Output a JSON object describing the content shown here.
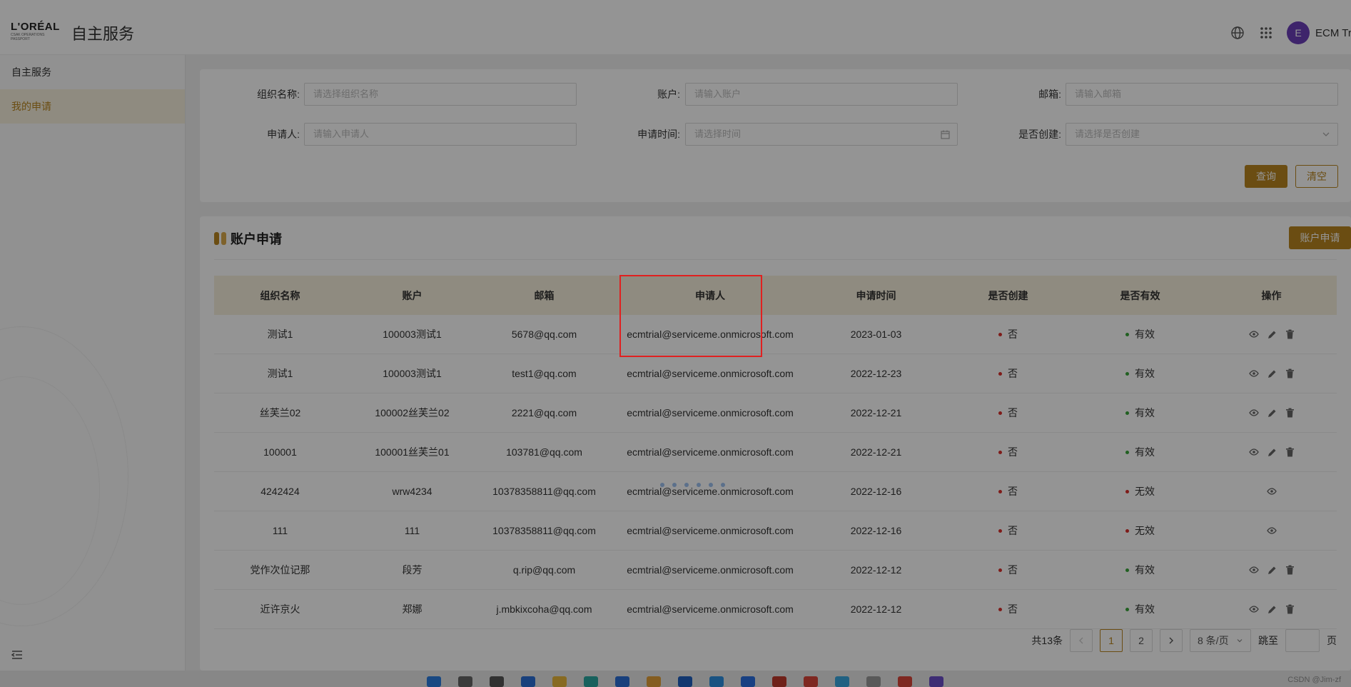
{
  "header": {
    "logo_brand": "L'ORÉAL",
    "logo_sub": "CSAK OPERATIONS PASSPORT",
    "app_title": "自主服务",
    "avatar_initial": "E",
    "user_name": "ECM Tri"
  },
  "sidebar": {
    "items": [
      {
        "label": "自主服务",
        "active": false
      },
      {
        "label": "我的申请",
        "active": true
      }
    ]
  },
  "filters": {
    "org_label": "组织名称:",
    "org_placeholder": "请选择组织名称",
    "account_label": "账户:",
    "account_placeholder": "请输入账户",
    "email_label": "邮箱:",
    "email_placeholder": "请输入邮箱",
    "applicant_label": "申请人:",
    "applicant_placeholder": "请输入申请人",
    "time_label": "申请时间:",
    "time_placeholder": "请选择时间",
    "created_label": "是否创建:",
    "created_placeholder": "请选择是否创建",
    "query_button": "查询",
    "clear_button": "清空"
  },
  "section": {
    "title": "账户申请",
    "apply_button": "账户申请"
  },
  "table": {
    "columns": [
      "组织名称",
      "账户",
      "邮箱",
      "申请人",
      "申请时间",
      "是否创建",
      "是否有效",
      "操作"
    ],
    "rows": [
      {
        "org": "测试1",
        "account": "100003测试1",
        "email": "5678@qq.com",
        "applicant": "ecmtrial@serviceme.onmicrosoft.com",
        "time": "2023-01-03",
        "created": "否",
        "valid": "有效",
        "editable": true
      },
      {
        "org": "测试1",
        "account": "100003测试1",
        "email": "test1@qq.com",
        "applicant": "ecmtrial@serviceme.onmicrosoft.com",
        "time": "2022-12-23",
        "created": "否",
        "valid": "有效",
        "editable": true
      },
      {
        "org": "丝芙兰02",
        "account": "100002丝芙兰02",
        "email": "2221@qq.com",
        "applicant": "ecmtrial@serviceme.onmicrosoft.com",
        "time": "2022-12-21",
        "created": "否",
        "valid": "有效",
        "editable": true
      },
      {
        "org": "100001",
        "account": "100001丝芙兰01",
        "email": "103781@qq.com",
        "applicant": "ecmtrial@serviceme.onmicrosoft.com",
        "time": "2022-12-21",
        "created": "否",
        "valid": "有效",
        "editable": true
      },
      {
        "org": "4242424",
        "account": "wrw4234",
        "email": "10378358811@qq.com",
        "applicant": "ecmtrial@serviceme.onmicrosoft.com",
        "time": "2022-12-16",
        "created": "否",
        "valid": "无效",
        "editable": false
      },
      {
        "org": "111",
        "account": "111",
        "email": "10378358811@qq.com",
        "applicant": "ecmtrial@serviceme.onmicrosoft.com",
        "time": "2022-12-16",
        "created": "否",
        "valid": "无效",
        "editable": false
      },
      {
        "org": "党作次位记那",
        "account": "段芳",
        "email": "q.rip@qq.com",
        "applicant": "ecmtrial@serviceme.onmicrosoft.com",
        "time": "2022-12-12",
        "created": "否",
        "valid": "有效",
        "editable": true
      },
      {
        "org": "近许京火",
        "account": "郑娜",
        "email": "j.mbkixcoha@qq.com",
        "applicant": "ecmtrial@serviceme.onmicrosoft.com",
        "time": "2022-12-12",
        "created": "否",
        "valid": "有效",
        "editable": true
      }
    ]
  },
  "pagination": {
    "total": "共13条",
    "pages": [
      "1",
      "2"
    ],
    "current": "1",
    "page_size": "8 条/页",
    "jump_label": "跳至",
    "page_unit": "页"
  },
  "colors": {
    "accent": "#b8861f",
    "status_no": "#d9302c",
    "status_valid": "#3aa53a",
    "status_invalid": "#d9302c",
    "highlight": "#e02020"
  },
  "watermark": "CSDN @Jim-zf"
}
